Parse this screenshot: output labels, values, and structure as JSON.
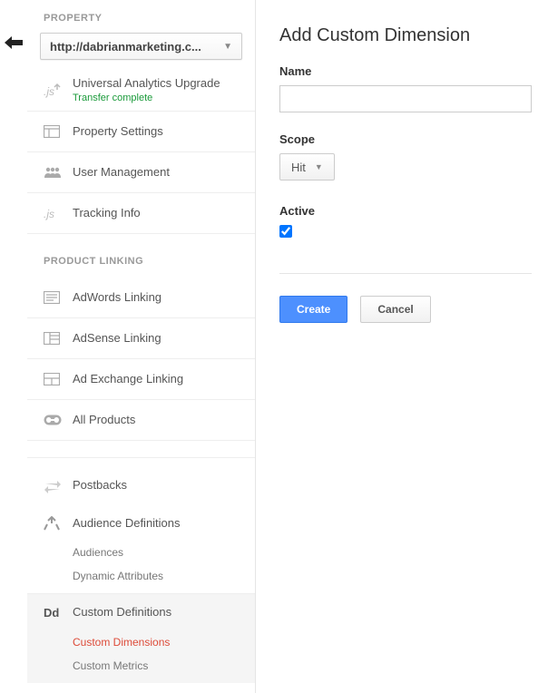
{
  "sidebar": {
    "section_header": "PROPERTY",
    "property_selector": "http://dabrianmarketing.c...",
    "items": {
      "upgrade_title": "Universal Analytics Upgrade",
      "upgrade_sub": "Transfer complete",
      "property_settings": "Property Settings",
      "user_management": "User Management",
      "tracking_info": "Tracking Info"
    },
    "product_linking_header": "PRODUCT LINKING",
    "linking": {
      "adwords": "AdWords Linking",
      "adsense": "AdSense Linking",
      "ad_exchange": "Ad Exchange Linking",
      "all_products": "All Products"
    },
    "postbacks": "Postbacks",
    "audience_definitions": "Audience Definitions",
    "audiences": "Audiences",
    "dynamic_attributes": "Dynamic Attributes",
    "custom_definitions": "Custom Definitions",
    "custom_dimensions": "Custom Dimensions",
    "custom_metrics": "Custom Metrics"
  },
  "main": {
    "title": "Add Custom Dimension",
    "name_label": "Name",
    "name_value": "",
    "scope_label": "Scope",
    "scope_value": "Hit",
    "active_label": "Active",
    "active_checked": true,
    "create_btn": "Create",
    "cancel_btn": "Cancel"
  }
}
